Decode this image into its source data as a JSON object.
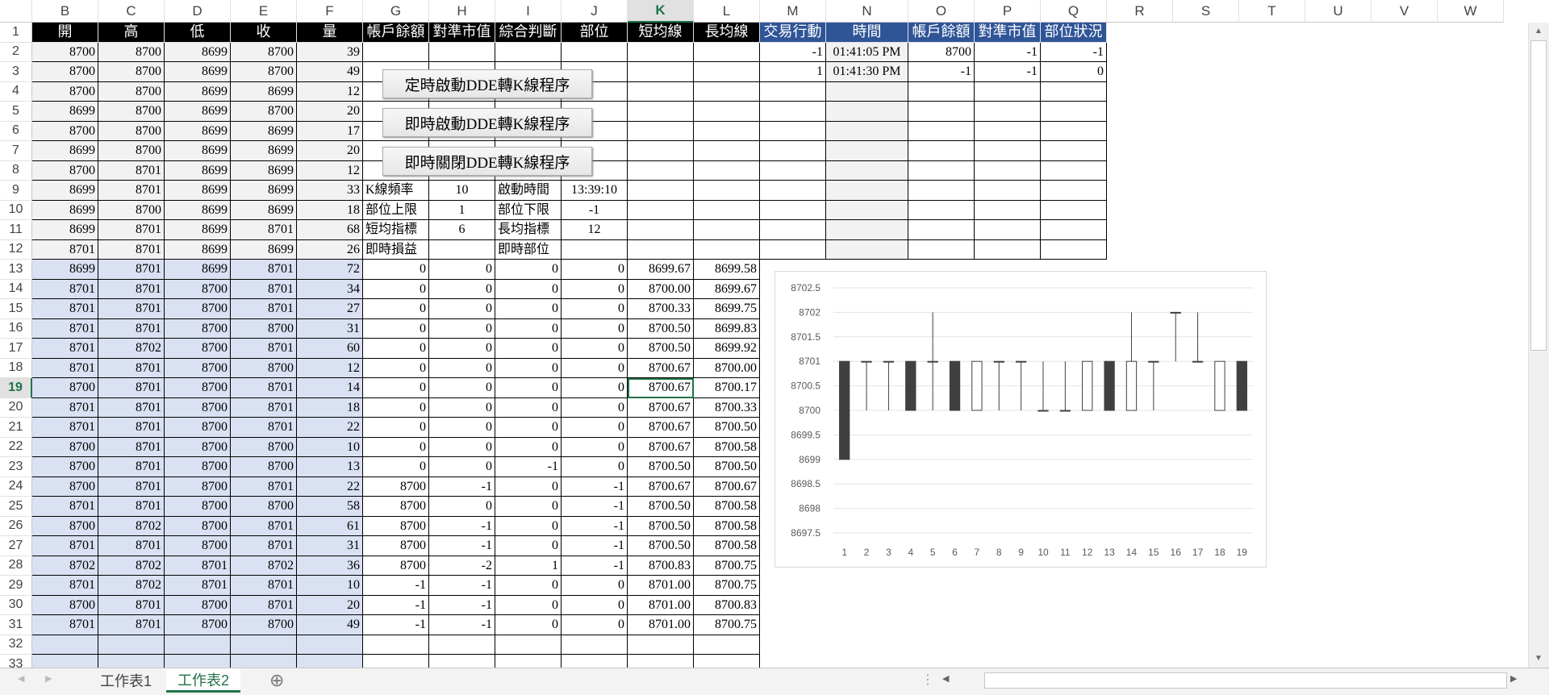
{
  "columns": [
    "B",
    "C",
    "D",
    "E",
    "F",
    "G",
    "H",
    "I",
    "J",
    "K",
    "L",
    "M",
    "N",
    "O",
    "P",
    "Q",
    "R",
    "S",
    "T",
    "U",
    "V",
    "W"
  ],
  "selected_column": "K",
  "selected_row": 19,
  "headers": {
    "left": [
      "開",
      "高",
      "低",
      "收",
      "量",
      "帳戶餘額",
      "對準市值",
      "綜合判斷",
      "部位",
      "短均線",
      "長均線"
    ],
    "right": [
      "交易行動",
      "時間",
      "帳戶餘額",
      "對準市值",
      "部位狀況"
    ]
  },
  "ohlcv": [
    [
      8700,
      8700,
      8699,
      8700,
      39
    ],
    [
      8700,
      8700,
      8699,
      8700,
      49
    ],
    [
      8700,
      8700,
      8699,
      8699,
      12
    ],
    [
      8699,
      8700,
      8699,
      8700,
      20
    ],
    [
      8700,
      8700,
      8699,
      8699,
      17
    ],
    [
      8699,
      8700,
      8699,
      8699,
      20
    ],
    [
      8700,
      8701,
      8699,
      8699,
      12
    ],
    [
      8699,
      8701,
      8699,
      8699,
      33
    ],
    [
      8699,
      8700,
      8699,
      8699,
      18
    ],
    [
      8699,
      8701,
      8699,
      8701,
      68
    ],
    [
      8701,
      8701,
      8699,
      8699,
      26
    ],
    [
      8699,
      8701,
      8699,
      8701,
      72
    ],
    [
      8701,
      8701,
      8700,
      8701,
      34
    ],
    [
      8701,
      8701,
      8700,
      8701,
      27
    ],
    [
      8701,
      8701,
      8700,
      8700,
      31
    ],
    [
      8701,
      8702,
      8700,
      8701,
      60
    ],
    [
      8701,
      8701,
      8700,
      8700,
      12
    ],
    [
      8700,
      8701,
      8700,
      8701,
      14
    ],
    [
      8701,
      8701,
      8700,
      8701,
      18
    ],
    [
      8701,
      8701,
      8700,
      8701,
      22
    ],
    [
      8700,
      8701,
      8700,
      8700,
      10
    ],
    [
      8700,
      8701,
      8700,
      8700,
      13
    ],
    [
      8700,
      8701,
      8700,
      8701,
      22
    ],
    [
      8701,
      8701,
      8700,
      8700,
      58
    ],
    [
      8700,
      8702,
      8700,
      8701,
      61
    ],
    [
      8701,
      8701,
      8700,
      8701,
      31
    ],
    [
      8702,
      8702,
      8701,
      8702,
      36
    ],
    [
      8701,
      8702,
      8701,
      8701,
      10
    ],
    [
      8700,
      8701,
      8700,
      8701,
      20
    ],
    [
      8701,
      8701,
      8700,
      8700,
      49
    ]
  ],
  "calc_rows": [
    [
      "0",
      "0",
      "0",
      "0",
      "8699.67",
      "8699.58"
    ],
    [
      "0",
      "0",
      "0",
      "0",
      "8700.00",
      "8699.67"
    ],
    [
      "0",
      "0",
      "0",
      "0",
      "8700.33",
      "8699.75"
    ],
    [
      "0",
      "0",
      "0",
      "0",
      "8700.50",
      "8699.83"
    ],
    [
      "0",
      "0",
      "0",
      "0",
      "8700.50",
      "8699.92"
    ],
    [
      "0",
      "0",
      "0",
      "0",
      "8700.67",
      "8700.00"
    ],
    [
      "0",
      "0",
      "0",
      "0",
      "8700.67",
      "8700.17"
    ],
    [
      "0",
      "0",
      "0",
      "0",
      "8700.67",
      "8700.33"
    ],
    [
      "0",
      "0",
      "0",
      "0",
      "8700.67",
      "8700.50"
    ],
    [
      "0",
      "0",
      "0",
      "0",
      "8700.67",
      "8700.58"
    ],
    [
      "0",
      "0",
      "-1",
      "0",
      "8700.50",
      "8700.50"
    ],
    [
      "8700",
      "-1",
      "0",
      "-1",
      "8700.67",
      "8700.67"
    ],
    [
      "8700",
      "0",
      "0",
      "-1",
      "8700.50",
      "8700.58"
    ],
    [
      "8700",
      "-1",
      "0",
      "-1",
      "8700.50",
      "8700.58"
    ],
    [
      "8700",
      "-1",
      "0",
      "-1",
      "8700.50",
      "8700.58"
    ],
    [
      "8700",
      "-2",
      "1",
      "-1",
      "8700.83",
      "8700.75"
    ],
    [
      "-1",
      "-1",
      "0",
      "0",
      "8701.00",
      "8700.75"
    ],
    [
      "-1",
      "-1",
      "0",
      "0",
      "8701.00",
      "8700.83"
    ],
    [
      "-1",
      "-1",
      "0",
      "0",
      "8701.00",
      "8700.75"
    ]
  ],
  "params": {
    "k_freq_label": "K線頻率",
    "k_freq": "10",
    "start_label": "啟動時間",
    "start_time": "13:39:10",
    "upper_label": "部位上限",
    "upper": "1",
    "lower_label": "部位下限",
    "lower": "-1",
    "short_label": "短均指標",
    "short": "6",
    "long_label": "長均指標",
    "long": "12",
    "pnl_label": "即時損益",
    "pos_label": "即時部位"
  },
  "trades": [
    {
      "action": "-1",
      "time": "01:41:05 PM",
      "balance": "8700",
      "market": "-1",
      "status": "-1"
    },
    {
      "action": "1",
      "time": "01:41:30 PM",
      "balance": "-1",
      "market": "-1",
      "status": "0"
    }
  ],
  "buttons": [
    "定時啟動DDE轉K線程序",
    "即時啟動DDE轉K線程序",
    "即時關閉DDE轉K線程序"
  ],
  "sheet_tabs": [
    "工作表1",
    "工作表2"
  ],
  "active_tab": "工作表2",
  "chart_data": {
    "type": "candlestick",
    "categories": [
      "1",
      "2",
      "3",
      "4",
      "5",
      "6",
      "7",
      "8",
      "9",
      "10",
      "11",
      "12",
      "13",
      "14",
      "15",
      "16",
      "17",
      "18",
      "19"
    ],
    "ohlc": [
      [
        8701,
        8701,
        8699,
        8699
      ],
      [
        8701,
        8701,
        8700,
        8701
      ],
      [
        8701,
        8701,
        8700,
        8701
      ],
      [
        8701,
        8701,
        8700,
        8700
      ],
      [
        8701,
        8702,
        8700,
        8701
      ],
      [
        8701,
        8701,
        8700,
        8700
      ],
      [
        8700,
        8701,
        8700,
        8701
      ],
      [
        8701,
        8701,
        8700,
        8701
      ],
      [
        8701,
        8701,
        8700,
        8701
      ],
      [
        8700,
        8701,
        8700,
        8700
      ],
      [
        8700,
        8701,
        8700,
        8700
      ],
      [
        8700,
        8701,
        8700,
        8701
      ],
      [
        8701,
        8701,
        8700,
        8700
      ],
      [
        8700,
        8702,
        8700,
        8701
      ],
      [
        8701,
        8701,
        8700,
        8701
      ],
      [
        8702,
        8702,
        8701,
        8702
      ],
      [
        8701,
        8702,
        8701,
        8701
      ],
      [
        8700,
        8701,
        8700,
        8701
      ],
      [
        8701,
        8701,
        8700,
        8700
      ]
    ],
    "ylim": [
      8697.5,
      8702.5
    ],
    "yticks": [
      "8697.5",
      "8698",
      "8698.5",
      "8699",
      "8699.5",
      "8700",
      "8700.5",
      "8701",
      "8701.5",
      "8702",
      "8702.5"
    ]
  }
}
